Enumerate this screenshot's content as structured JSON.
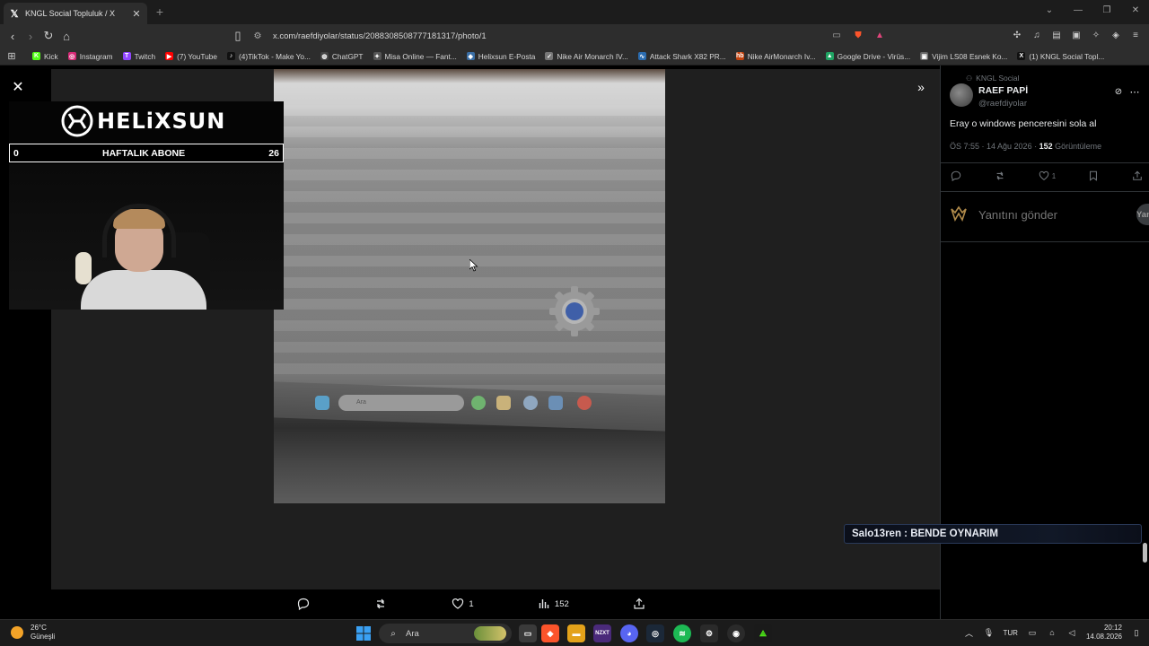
{
  "browser": {
    "tab_title": "KNGL Social Topluluk / X",
    "url": "x.com/raefdiyolar/status/2088308508777181317/photo/1",
    "bookmarks": [
      {
        "label": "Kick",
        "color": "#53fc18",
        "glyph": "K"
      },
      {
        "label": "Instagram",
        "color": "#d62976",
        "glyph": "◎"
      },
      {
        "label": "Twitch",
        "color": "#9146ff",
        "glyph": "T"
      },
      {
        "label": "(7) YouTube",
        "color": "#ff0000",
        "glyph": "▶"
      },
      {
        "label": "(4)TikTok - Make Yo...",
        "color": "#111111",
        "glyph": "♪"
      },
      {
        "label": "ChatGPT",
        "color": "#444444",
        "glyph": "◍"
      },
      {
        "label": "Misa Online — Fant...",
        "color": "#555555",
        "glyph": "✦"
      },
      {
        "label": "Helixsun E-Posta",
        "color": "#3a6ea5",
        "glyph": "◆"
      },
      {
        "label": "Nike Air Monarch IV...",
        "color": "#777777",
        "glyph": "✓"
      },
      {
        "label": "Attack Shark X82 PR...",
        "color": "#2b6cb0",
        "glyph": "∿"
      },
      {
        "label": "Nike AirMonarch Iv...",
        "color": "#c2410c",
        "glyph": "hb"
      },
      {
        "label": "Google Drive - Virüs...",
        "color": "#1fa463",
        "glyph": "▲"
      },
      {
        "label": "Vijim LS08 Esnek Ko...",
        "color": "#666666",
        "glyph": "▣"
      },
      {
        "label": "(1) KNGL Social Topl...",
        "color": "#111111",
        "glyph": "X"
      }
    ]
  },
  "overlay": {
    "brand": "HELiXSUN",
    "sub_left": "0",
    "sub_label": "HAFTALIK ABONE",
    "sub_right": "26"
  },
  "photo": {
    "search_text": "Ara"
  },
  "media_actions": {
    "likes": "1",
    "views": "152"
  },
  "tweet": {
    "community": "KNGL Social",
    "author_name": "RAEF PAPİ",
    "author_handle": "@raefdiyolar",
    "text": "Eray o windows penceresini sola al",
    "time": "ÖS 7:55 · 14 Ağu 2026 · ",
    "views_count": "152",
    "views_label": " Görüntüleme",
    "likes": "1",
    "reply_placeholder": "Yanıtını gönder",
    "reply_button": "Yanıtla"
  },
  "chat": {
    "message": "Salo13ren : BENDE OYNARIM"
  },
  "taskbar": {
    "weather_temp": "26°C",
    "weather_desc": "Güneşli",
    "search_placeholder": "Ara",
    "lang": "TUR",
    "time": "20:12",
    "date": "14.08.2026"
  }
}
